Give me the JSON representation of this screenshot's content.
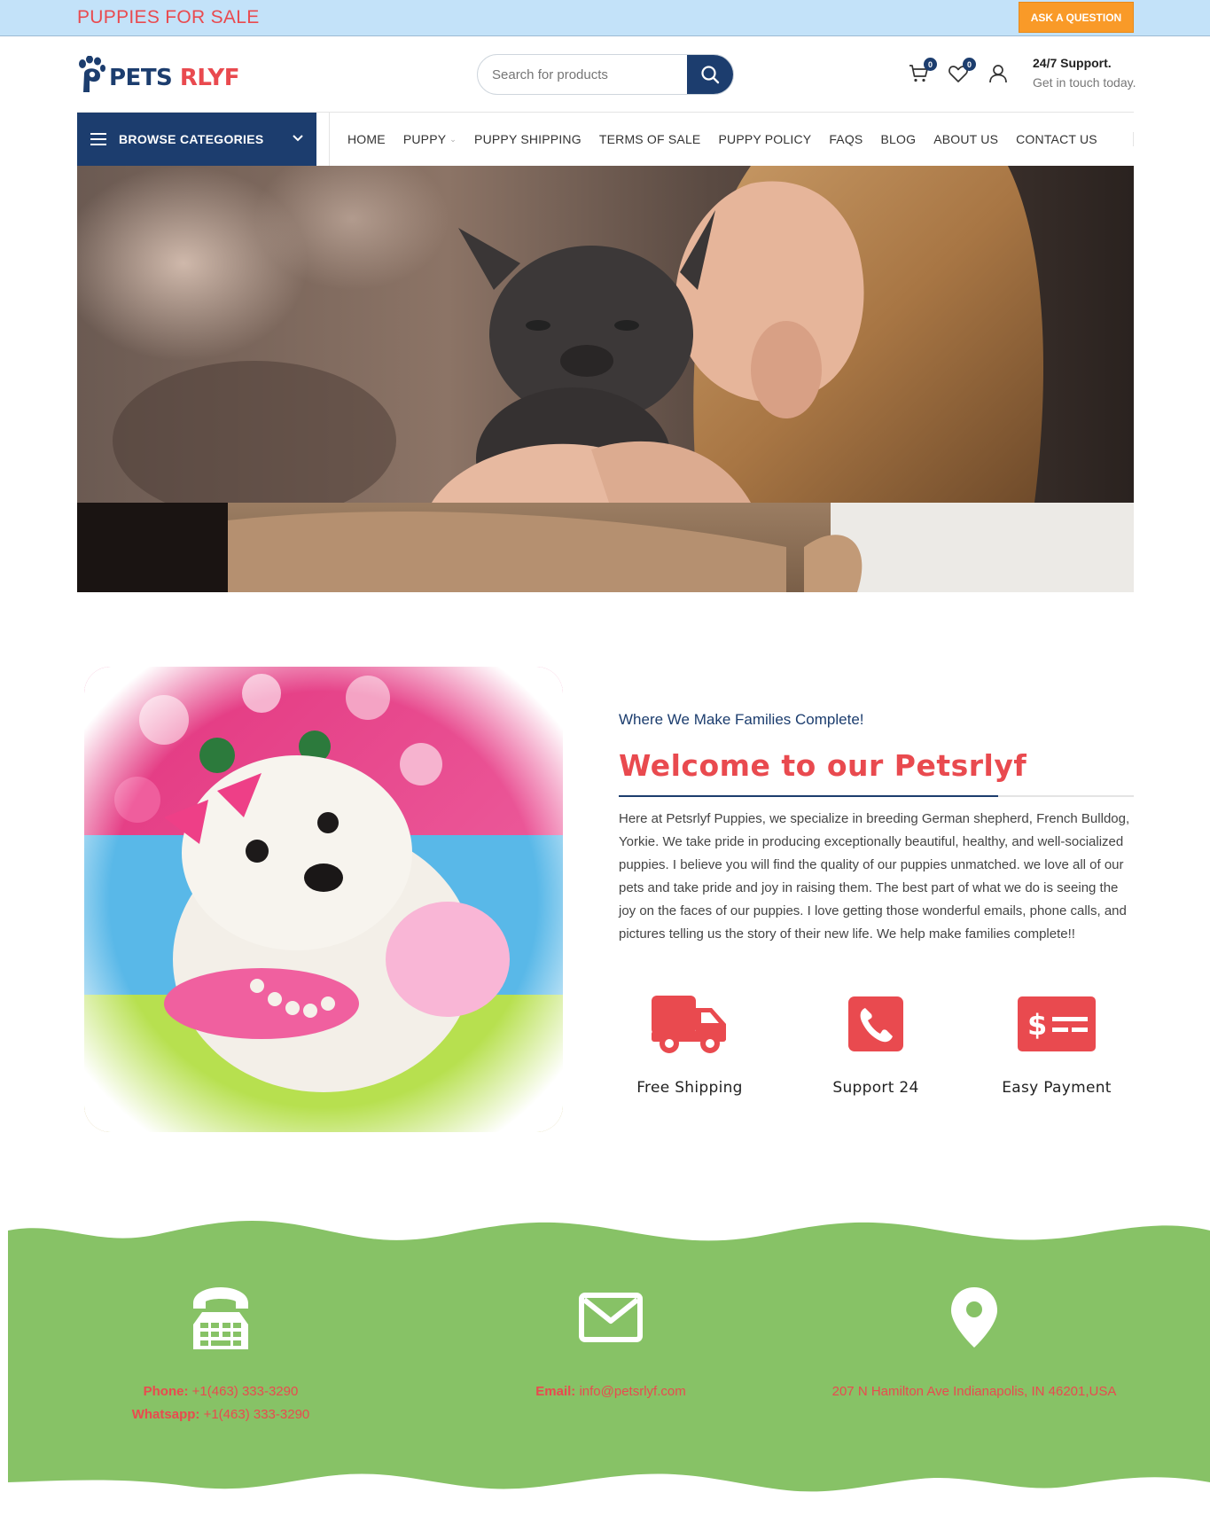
{
  "topbar": {
    "promo": "PUPPIES FOR SALE",
    "ask_button": "ASK A QUESTION"
  },
  "header": {
    "logo": {
      "part1": "PETS",
      "part2": "R",
      "part3": "LYF"
    },
    "search": {
      "placeholder": "Search for products"
    },
    "cart_count": "0",
    "wishlist_count": "0",
    "support_title": "24/7 Support.",
    "support_subtitle": "Get in touch today."
  },
  "nav": {
    "browse_label": "BROWSE CATEGORIES",
    "items": [
      "HOME",
      "PUPPY",
      "PUPPY SHIPPING",
      "TERMS OF SALE",
      "PUPPY POLICY",
      "FAQS",
      "BLOG",
      "ABOUT US",
      "CONTACT US"
    ]
  },
  "welcome": {
    "tagline": "Where We Make Families Complete!",
    "heading": "Welcome to our Petsrlyf",
    "body": "Here at Petsrlyf Puppies, we specialize in breeding German shepherd, French Bulldog, Yorkie. We take pride in producing exceptionally beautiful, healthy, and well-socialized puppies. I believe you will find the quality of our puppies unmatched. we love all of our pets and take pride and joy in raising them. The best part of what we do is seeing the joy on the faces of our puppies. I love getting those wonderful emails, phone calls, and pictures telling us the story of their new life. We help make families complete!!"
  },
  "features": [
    {
      "label": "Free Shipping",
      "icon": "truck-icon"
    },
    {
      "label": "Support 24",
      "icon": "phone-icon"
    },
    {
      "label": "Easy Payment",
      "icon": "payment-card-icon"
    }
  ],
  "contact": {
    "phone_label": "Phone:",
    "phone": "+1(463) 333-3290",
    "whatsapp_label": "Whatsapp:",
    "whatsapp": "+1(463) 333-3290",
    "email_label": "Email:",
    "email": "info@petsrlyf.com",
    "address": "207 N Hamilton Ave Indianapolis, IN 46201,USA"
  },
  "colors": {
    "brand_navy": "#1c3d6e",
    "brand_red": "#e94a4f",
    "topbar_blue": "#c3e2f9",
    "ask_orange": "#f99a28",
    "footer_green": "#87c266"
  }
}
